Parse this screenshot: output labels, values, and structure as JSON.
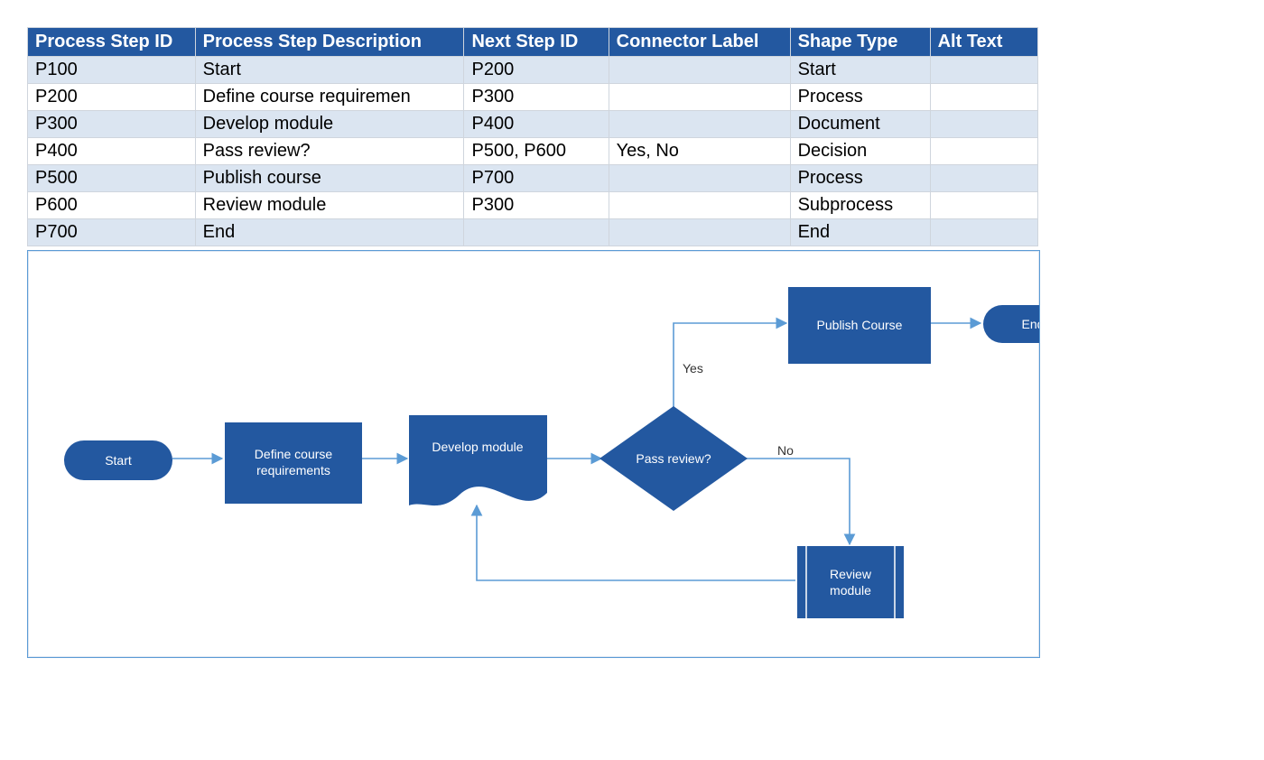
{
  "table": {
    "headers": {
      "c1": "Process Step ID",
      "c2": "Process Step Description",
      "c3": "Next Step ID",
      "c4": "Connector Label",
      "c5": "Shape Type",
      "c6": "Alt Text"
    },
    "rows": [
      {
        "c1": "P100",
        "c2": "Start",
        "c3": "P200",
        "c4": "",
        "c5": "Start",
        "c6": ""
      },
      {
        "c1": "P200",
        "c2": "Define course requiremen",
        "c3": "P300",
        "c4": "",
        "c5": "Process",
        "c6": ""
      },
      {
        "c1": "P300",
        "c2": "Develop module",
        "c3": "P400",
        "c4": "",
        "c5": "Document",
        "c6": ""
      },
      {
        "c1": "P400",
        "c2": "Pass review?",
        "c3": "P500, P600",
        "c4": "Yes, No",
        "c5": "Decision",
        "c6": ""
      },
      {
        "c1": "P500",
        "c2": "Publish course",
        "c3": "P700",
        "c4": "",
        "c5": "Process",
        "c6": ""
      },
      {
        "c1": "P600",
        "c2": "Review module",
        "c3": "P300",
        "c4": "",
        "c5": "Subprocess",
        "c6": ""
      },
      {
        "c1": "P700",
        "c2": "End",
        "c3": "",
        "c4": "",
        "c5": "End",
        "c6": ""
      }
    ]
  },
  "diagram": {
    "shapes": {
      "start": {
        "label": "Start"
      },
      "define": {
        "label1": "Define course",
        "label2": "requirements"
      },
      "develop": {
        "label": "Develop module"
      },
      "decision": {
        "label": "Pass review?"
      },
      "publish": {
        "label": "Publish Course"
      },
      "end": {
        "label": "End"
      },
      "review": {
        "label1": "Review",
        "label2": "module"
      }
    },
    "connectors": {
      "yes": "Yes",
      "no": "No"
    }
  }
}
